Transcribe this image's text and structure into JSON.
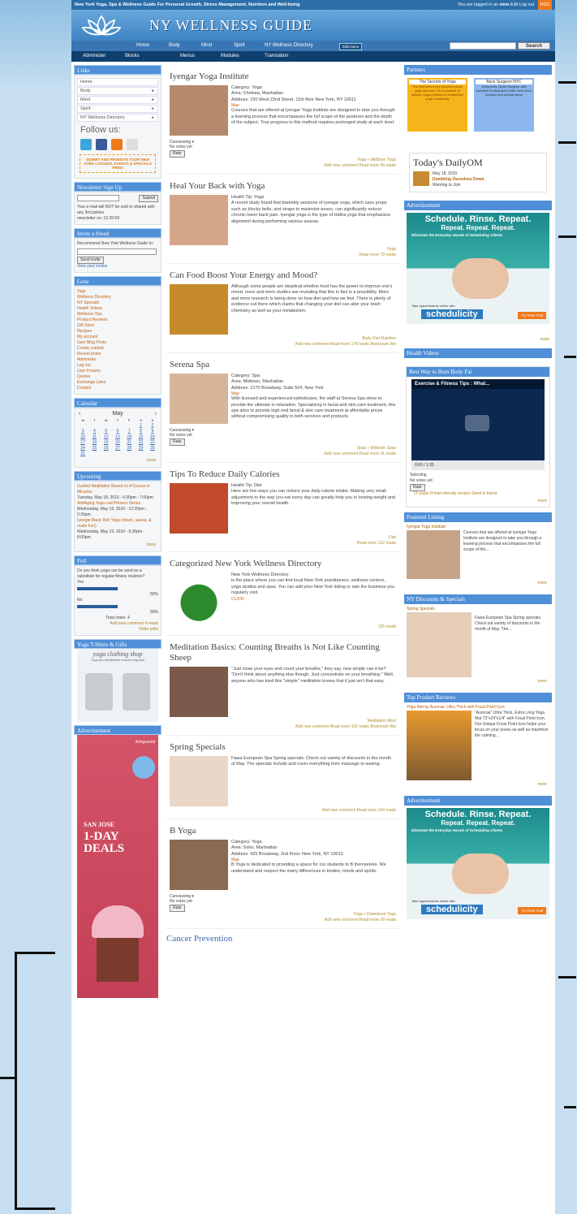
{
  "topbar": {
    "tagline": "New York Yoga, Spa & Wellness Guide For Personal Growth, Stress Management, Nutrition and Well-being",
    "login_text": "You are logged in as",
    "user": "view",
    "links": "Edit",
    "logout": "Log out",
    "rss": "RSS"
  },
  "header": {
    "site_name": "NY WELLNESS GUIDE"
  },
  "nav": {
    "items": [
      "Home",
      "Body",
      "Mind",
      "Spirit",
      "NY Wellness Directory"
    ],
    "edit_menu": "Edit menu",
    "search_button": "Search"
  },
  "admin_bar": {
    "items": [
      "Administer",
      "Blocks",
      "Menus",
      "Modules",
      "Translation"
    ]
  },
  "left": {
    "links_title": "Links",
    "links": [
      "Home",
      "Body",
      "Mind",
      "Spirit",
      "NY Wellness Directory"
    ],
    "follow_us": "Follow us:",
    "promo": "SUBMIT AND PROMOTE YOUR NEW YORK LISTINGS, EVENTS & SPECIALS FREE!",
    "newsletter_title": "Newsletter Sign Up",
    "newsletter_submit": "Submit",
    "newsletter_note": "Your e-mail will NOT be sold or shared with any 3rd parties.",
    "newsletter_stat": "newsletter on: 12:26:59",
    "invite_title": "Invite a friend",
    "invite_text": "Recommend New York Wellness Guide to:",
    "invite_button": "Send invite",
    "invite_link": "View your invites",
    "user_title": "Gene",
    "user_links": [
      "Tags",
      "Wellness Directory",
      "NY Specials",
      "Health Videos",
      "Wellness Tips",
      "Product Reviews",
      "Gift Store",
      "Recipes",
      "My account",
      "User Blog Posts",
      "Create content",
      "Recent posts",
      "Administer",
      "Log out",
      "User Forums",
      "Quotes",
      "Exchange Links",
      "Contact"
    ],
    "calendar_title": "Calendar",
    "calendar_month": "May",
    "calendar_days": [
      "M",
      "T",
      "W",
      "T",
      "F",
      "S",
      "S"
    ],
    "calendar_dates": [
      "",
      "",
      "",
      "",
      "",
      "1",
      "2",
      "3",
      "4",
      "5",
      "6",
      "7",
      "8",
      "9",
      "10",
      "11",
      "12",
      "13",
      "14",
      "15",
      "16",
      "17",
      "18",
      "19",
      "20",
      "21",
      "22",
      "23",
      "24",
      "25",
      "26",
      "27",
      "28",
      "29",
      "30",
      "31"
    ],
    "calendar_more": "more",
    "upcoming_title": "Upcoming",
    "upcoming": [
      {
        "title": "Guided Meditation Based on A Course in Miracles",
        "date": "Tuesday, May 18, 2010 - 6:30pm - 7:00pm"
      },
      {
        "title": "AntiAging Yoga Led Primero Series",
        "date": "Wednesday, May 19, 2010 - 12:20pm - 2:30pm"
      },
      {
        "title": "Iyengar Basic Roll Yoga (return, sauna, & roulle fun!)",
        "date": "Wednesday, May 19, 2010 - 6:30pm - 8:00pm"
      }
    ],
    "upcoming_more": "more",
    "poll_title": "Poll",
    "poll_question": "Do you think yoga can be used as a substitute for regular fitness routines?",
    "poll_yes": "Yes",
    "poll_yes_pct": "50%",
    "poll_no": "No",
    "poll_no_pct": "50%",
    "poll_total": "Total votes: 4",
    "poll_links": "Add new comment   4 reads",
    "poll_older": "Older polls",
    "tshirts_title": "Yoga T-Shirts & Gifts",
    "tshirts_brand": "yoga clothing shop",
    "tshirts_sub": "Yoga and Meditation Inspired Apparel",
    "ad_title": "Advertisement",
    "ad_brand": "livingsocial",
    "ad_city": "SAN JOSE",
    "ad_deals": "1-DAY DEALS"
  },
  "posts": [
    {
      "title": "Iyengar Yoga Institute",
      "lines": [
        "Category: Yoga",
        "Area: Chelsea, Manhattan",
        "Address: 150 West 22nd Street, 11th floor New York, NY 10011"
      ],
      "map": "Map",
      "body": "Courses that are offered at Iyengar Yoga Institute are designed to take you through a learning process that encompasses the full scope of the postures and the depth of the subject. True progress in this method requires prolonged study at each level.",
      "voting": "Canvassing",
      "vote_note": "No votes yet",
      "rate": "Rate",
      "tags": "Yoga » Midtown   Yoga",
      "meta": "Add new comment   Read more   49 reads"
    },
    {
      "title": "Heal Your Back with Yoga",
      "lines": [
        "Health Tip: Yoga"
      ],
      "map": "",
      "body": "A recent study found that biweekly sessions of Iyengar yoga, which uses props such as blocks belts, and straps to maximize poses, can significantly reduce chronic lower back pain. Iyengar yoga is the type of Hatha yoga that emphasizes alignment during performing various asanas.",
      "voting": "",
      "vote_note": "",
      "rate": "",
      "tags": "Yoga",
      "meta": "Read more   79 reads"
    },
    {
      "title": "Can Food Boost Your Energy and Mood?",
      "lines": [],
      "map": "",
      "body": "Although some people are skeptical whether food has the power to improve one's mood, more and more studies are revealing that this in fact is a possibility. More and more research is being done on how diet and how we feel. There is plenty of evidence out there which claims that changing your diet can alter your brain chemistry as well as your metabolism.",
      "voting": "",
      "vote_note": "",
      "rate": "",
      "tags": "Body   Diet   Nutrition",
      "meta": "Add new comment   Read more   178 reads   Bookmark this"
    },
    {
      "title": "Serena Spa",
      "lines": [
        "Category: Spa",
        "Area: Midtown, Manhattan",
        "Address: 1270 Broadway, Suite 504, New York"
      ],
      "map": "Map",
      "body": "With licensed and experienced estheticians, the staff at Serena Spa strive to provide the ultimate in relaxation. Specializing in facial and skin care treatment, this spa aims to provide high end facial & skin care treatment at affordable prices without compromising quality in both services and products.",
      "voting": "Canvassing",
      "vote_note": "No votes yet",
      "rate": "Rate",
      "tags": "Spas » Midtown   Spas",
      "meta": "Add new comment   Read more   41 reads"
    },
    {
      "title": "Tips To Reduce Daily Calories",
      "lines": [
        "Health Tip: Diet"
      ],
      "map": "",
      "body": "Here are few ways you can reduce your daily calorie intake. Making very small adjustment to the way you eat every day can greatly help you in loosing weight and improving your overall health.",
      "voting": "",
      "vote_note": "",
      "rate": "",
      "tags": "Diet",
      "meta": "Read more   132 reads"
    },
    {
      "title": "Categorized New York Wellness Directory",
      "lines": [
        "New York Wellness Directory"
      ],
      "map": "",
      "body": "is the place where you can find local New York practitioners, wellness centers, yoga studios and spas. You can add your New York listing or rate the business you regularly visit.",
      "link": "CLICK!",
      "voting": "",
      "vote_note": "",
      "rate": "",
      "tags": "",
      "meta": "135 reads"
    },
    {
      "title": "Meditation Basics: Counting Breaths is Not Like Counting Sheep",
      "lines": [],
      "map": "",
      "body": "\"Just close your eyes and count your breaths,\" they say, now simple can it be? \"Don't think about anything else though. Just concentrate on your breathing.\" Well, anyone who has tried this \"simple\" meditation knows that it just isn't that easy.",
      "voting": "",
      "vote_note": "",
      "rate": "",
      "tags": "Meditation   Mind",
      "meta": "Add new comment   Read more   101 reads   Bookmark this"
    },
    {
      "title": "Spring Specials",
      "lines": [],
      "map": "",
      "body": "Fawa European Spa Spring specials. Check out variety of discounts in the month of May. The specials include and cover everything from massage to waxing.",
      "voting": "",
      "vote_note": "",
      "rate": "",
      "tags": "",
      "meta": "Add new comment   Read more   144 reads"
    },
    {
      "title": "B Yoga",
      "lines": [
        "Category: Yoga",
        "Area: Soho, Manhattan",
        "Address: 425 Broadway, 2nd Floor, New York, NY 10013"
      ],
      "map": "Map",
      "body": "B Yoga is dedicated to providing a space for our students to B themselves. We understand and respect the many differences in bodies, minds and spirits.",
      "voting": "Canvassing",
      "vote_note": "No votes yet",
      "rate": "Rate",
      "tags": "Yoga » Downtown   Yoga",
      "meta": "Add new comment   Read more   39 reads"
    }
  ],
  "last_post_title": "Cancer Prevention",
  "right": {
    "partners_title": "Partners",
    "partner1_title": "The Secrets of Yoga",
    "partner1_text": "The internet's most comprehensive yoga resource, 25 thousands of articles, yoga positions & embedded yoga community",
    "partner2_title": "Back Surgeon NYC",
    "partner2_text": "Orthopedic Spine Surgeon with expertise in disorders of the neck back, thoracic and lumbar spine",
    "dailyom_title": "Today's DailyOM",
    "dailyom_date": "May 18, 2010",
    "dailyom_headline": "Dumbling Ourselves Down",
    "dailyom_sub": "Wanting to Join",
    "ad_title": "Advertisement",
    "ad_h1": "Schedule. Rinse. Repeat.",
    "ad_h2": "Repeat. Repeat. Repeat.",
    "ad_h3": "Eliminate the Everyday Hassle of Scheduling Clients",
    "ad_tag": "Take appointments online with",
    "ad_logo": "schedulicity",
    "ad_cta": "Try Free Trial",
    "ad_more": "more",
    "videos_title": "Health Videos",
    "video_box_title": "Best Way to Burn Body Fat",
    "video_caption": "Exercise & Fitness Tips : What...",
    "video_time": "0:00 / 1:35",
    "video_voting": "Selecting",
    "video_votes": "No votes yet",
    "video_rate": "Rate",
    "video_meta": "72 reads   Printer-friendly version   Send to friend",
    "video_more": "more",
    "featured_title": "Featured Listing",
    "featured_name": "Iyengar Yoga Institute",
    "featured_text": "Courses that are offered at Iyengar Yoga Institute are designed to take you through a learning process that encompasses the full scope of the...",
    "featured_more": "more",
    "discounts_title": "NY Discounts & Specials",
    "discounts_name": "Spring Specials",
    "discounts_text": "Fawa European Spa Spring specials. Check out variety of discounts in the month of May. The...",
    "discounts_more": "more",
    "reviews_title": "Top Product Reviews",
    "reviews_name": "Yoga Mat by Aurorae, Ultra Thick with Focal Point Icon",
    "reviews_text": "\"Aurorae\" Ultra Thick, Extra Long Yoga Mat 72\"x24\"x1/4\" with Focal Point Icon. Our Unique Focal Point Icon helps your focus on your poses as well as maximize the calming...",
    "reviews_more": "more",
    "ad2_title": "Advertisement"
  }
}
